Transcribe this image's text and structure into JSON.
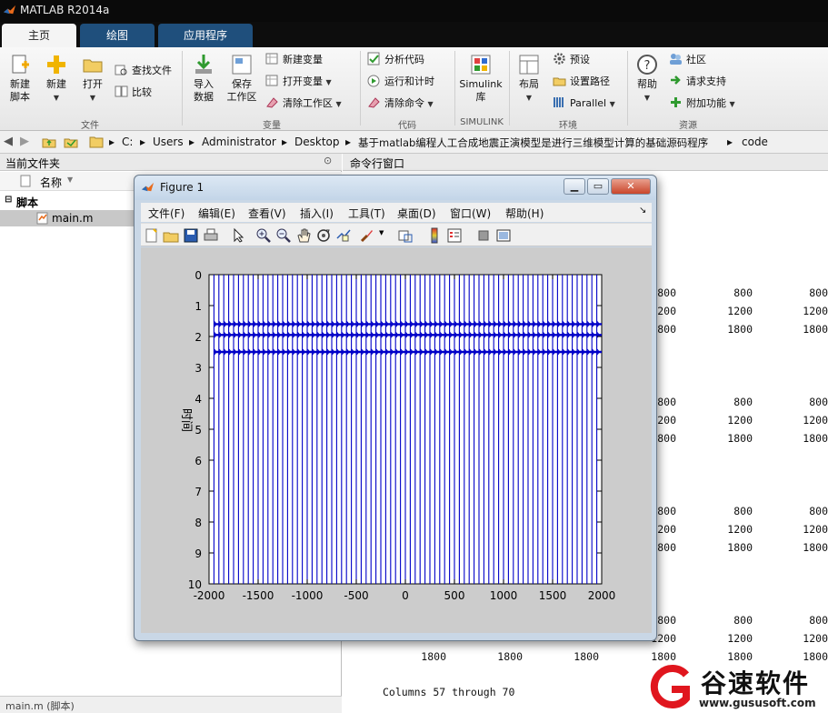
{
  "app": {
    "title": "MATLAB R2014a"
  },
  "tabs": [
    {
      "label": "主页"
    },
    {
      "label": "绘图"
    },
    {
      "label": "应用程序"
    }
  ],
  "ribbon": {
    "file": {
      "new_script": [
        "新建",
        "脚本"
      ],
      "new": "新建",
      "open": "打开",
      "find_files": "查找文件",
      "compare": "比较",
      "group": "文件"
    },
    "variable": {
      "import": [
        "导入",
        "数据"
      ],
      "save": [
        "保存",
        "工作区"
      ],
      "new_var": "新建变量",
      "open_var": "打开变量",
      "clear_ws": "清除工作区",
      "group": "变量"
    },
    "code": {
      "analyze": "分析代码",
      "run_time": "运行和计时",
      "clear_cmd": "清除命令",
      "group": "代码"
    },
    "simulink": {
      "label": [
        "Simulink",
        "库"
      ],
      "group": "SIMULINK"
    },
    "environment": {
      "layout": "布局",
      "prefs": "预设",
      "set_path": "设置路径",
      "parallel": "Parallel",
      "group": "环境"
    },
    "resources": {
      "help": "帮助",
      "community": "社区",
      "request_support": "请求支持",
      "addons": "附加功能",
      "group": "资源"
    }
  },
  "address": {
    "crumbs": [
      "C:",
      "Users",
      "Administrator",
      "Desktop",
      "基于matlab编程人工合成地震正演模型是进行三维模型计算的基础源码程序",
      "code"
    ]
  },
  "left_panel": {
    "title": "当前文件夹",
    "column_name": "名称",
    "group": "脚本",
    "file": "main.m",
    "status": "main.m (脚本)"
  },
  "command_window": {
    "title": "命令行窗口",
    "rows": [
      [
        "800",
        "800",
        "800"
      ],
      [
        "1200",
        "1200",
        "1200"
      ],
      [
        "1800",
        "1800",
        "1800"
      ],
      [
        "800",
        "800",
        "800"
      ],
      [
        "1200",
        "1200",
        "1200"
      ],
      [
        "1800",
        "1800",
        "1800"
      ],
      [
        "800",
        "800",
        "800"
      ],
      [
        "1200",
        "1200",
        "1200"
      ],
      [
        "1800",
        "1800",
        "1800"
      ],
      [
        "800",
        "800",
        "800"
      ],
      [
        "1200",
        "1200",
        "1200"
      ]
    ],
    "last_row": [
      "1800",
      "1800",
      "1800",
      "1800",
      "1800",
      "1800"
    ],
    "columns_text": "Columns 57 through 70"
  },
  "figure": {
    "title": "Figure 1",
    "menu": [
      "文件(F)",
      "编辑(E)",
      "查看(V)",
      "插入(I)",
      "工具(T)",
      "桌面(D)",
      "窗口(W)",
      "帮助(H)"
    ]
  },
  "chart_data": {
    "type": "line",
    "xlim": [
      -2000,
      2000
    ],
    "ylim": [
      0,
      10
    ],
    "y_reversed": true,
    "x_ticks": [
      "-2000",
      "-1500",
      "-1000",
      "-500",
      "0",
      "500",
      "1000",
      "1500",
      "2000"
    ],
    "y_ticks": [
      "0",
      "1",
      "2",
      "3",
      "4",
      "5",
      "6",
      "7",
      "8",
      "9",
      "10"
    ],
    "ylabel": "时间",
    "trace_x": [
      -1950,
      -1900,
      -1850,
      -1800,
      -1750,
      -1700,
      -1650,
      -1600,
      -1550,
      -1500,
      -1450,
      -1400,
      -1350,
      -1300,
      -1250,
      -1200,
      -1150,
      -1100,
      -1050,
      -1000,
      -950,
      -900,
      -850,
      -800,
      -750,
      -700,
      -650,
      -600,
      -550,
      -500,
      -450,
      -400,
      -350,
      -300,
      -250,
      -200,
      -150,
      -100,
      -50,
      0,
      50,
      100,
      150,
      200,
      250,
      300,
      350,
      400,
      450,
      500,
      550,
      600,
      650,
      700,
      750,
      800,
      850,
      900,
      950,
      1000,
      1050,
      1100,
      1150,
      1200,
      1250,
      1300,
      1350,
      1400,
      1450,
      1500,
      1550,
      1600,
      1650,
      1700,
      1750,
      1800,
      1850,
      1900,
      1950
    ],
    "reflection_times": [
      1.6,
      1.95,
      2.5
    ],
    "trace_range": [
      0,
      10
    ],
    "reflector_x_range": [
      -1950,
      2000
    ],
    "line_color": "#0000c8"
  },
  "watermark": {
    "brand": "谷速软件",
    "url": "www.gususoft.com"
  },
  "colors": {
    "accent": "#1f4f7c",
    "trace": "#0000c8",
    "watermark": "#e0161e"
  }
}
